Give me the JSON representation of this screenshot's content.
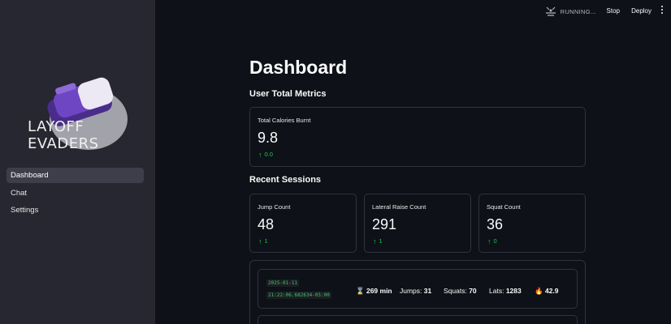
{
  "header": {
    "status": "RUNNING...",
    "stop_label": "Stop",
    "deploy_label": "Deploy"
  },
  "sidebar": {
    "logo_line1": "LAYOFF",
    "logo_line2": "EVADERS",
    "items": [
      {
        "label": "Dashboard",
        "active": true
      },
      {
        "label": "Chat",
        "active": false
      },
      {
        "label": "Settings",
        "active": false
      }
    ]
  },
  "main": {
    "title": "Dashboard",
    "total_section": "User Total Metrics",
    "total_card": {
      "label": "Total Calories Burnt",
      "value": "9.8",
      "delta": "0.0"
    },
    "recent_section": "Recent Sessions",
    "cards": [
      {
        "label": "Jump Count",
        "value": "48",
        "delta": "1"
      },
      {
        "label": "Lateral Raise Count",
        "value": "291",
        "delta": "1"
      },
      {
        "label": "Squat Count",
        "value": "36",
        "delta": "0"
      }
    ],
    "session": {
      "date": "2025-01-11",
      "time": "21:22:06.682634-05:00",
      "duration": "269 min",
      "jumps_label": "Jumps:",
      "jumps": "31",
      "squats_label": "Squats:",
      "squats": "70",
      "lats_label": "Lats:",
      "lats": "1283",
      "calories": "42.9"
    }
  },
  "colors": {
    "accent_green": "#21c354",
    "sidebar_bg": "#262730",
    "main_bg": "#0e1117"
  },
  "icons": [
    "running-icon",
    "arrow-up-icon",
    "hourglass-icon",
    "fire-icon",
    "menu-icon"
  ]
}
